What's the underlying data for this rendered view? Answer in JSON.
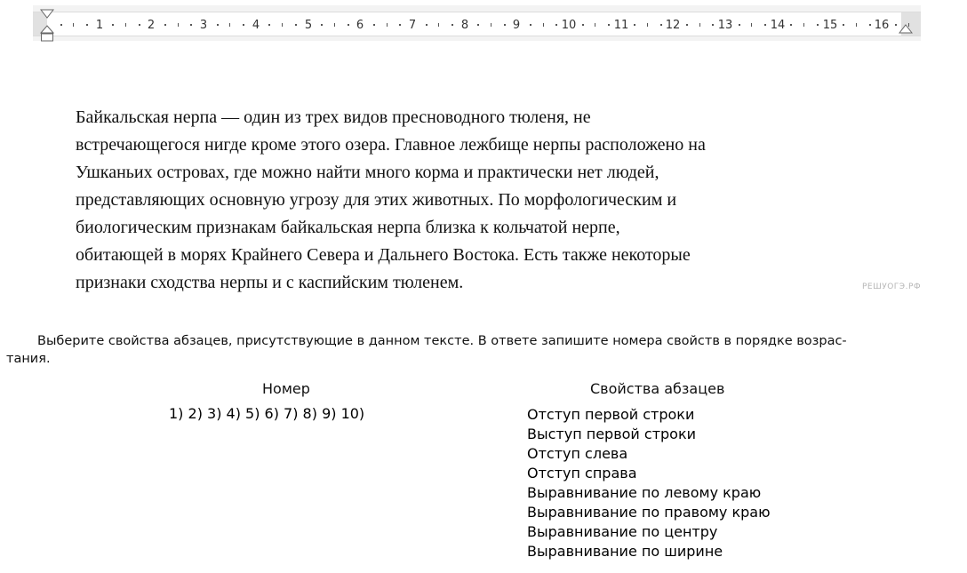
{
  "ruler": {
    "numbers": [
      "1",
      "2",
      "3",
      "4",
      "5",
      "6",
      "7",
      "8",
      "9",
      "10",
      "11",
      "12",
      "13",
      "14",
      "15",
      "16"
    ]
  },
  "document": {
    "lines": [
      "Байкальская нерпа — один из трех видов пресноводного тюленя, не",
      "встречающегося нигде кроме этого озера. Главное лежбище нерпы расположено на",
      "Ушканьих островах, где можно найти много корма и практически нет людей,",
      "представляющих основную угрозу для этих животных. По морфологическим и",
      "биологическим признакам байкальская нерпа близка к кольчатой нерпе,",
      "обитающей в морях Крайнего Севера и Дальнего Востока. Есть также некоторые",
      "признаки сходства нерпы и с каспийским тюленем."
    ],
    "watermark": "РЕШУОГЭ.РФ"
  },
  "question": {
    "line1": "Выберите свойства абзацев, присутствующие в данном тексте. В ответе запишите номера свойств в порядке возрас-",
    "line2": "тания."
  },
  "table": {
    "header_number": "Номер",
    "header_props": "Свойства абзацев",
    "numbers": "1) 2) 3) 4) 5) 6) 7) 8) 9) 10)",
    "properties": [
      "Отступ первой строки",
      "Выступ первой строки",
      "Отступ слева",
      "Отступ справа",
      "Выравнивание по левому краю",
      "Выравнивание по правому краю",
      "Выравнивание по центру",
      "Выравнивание по ширине"
    ]
  }
}
